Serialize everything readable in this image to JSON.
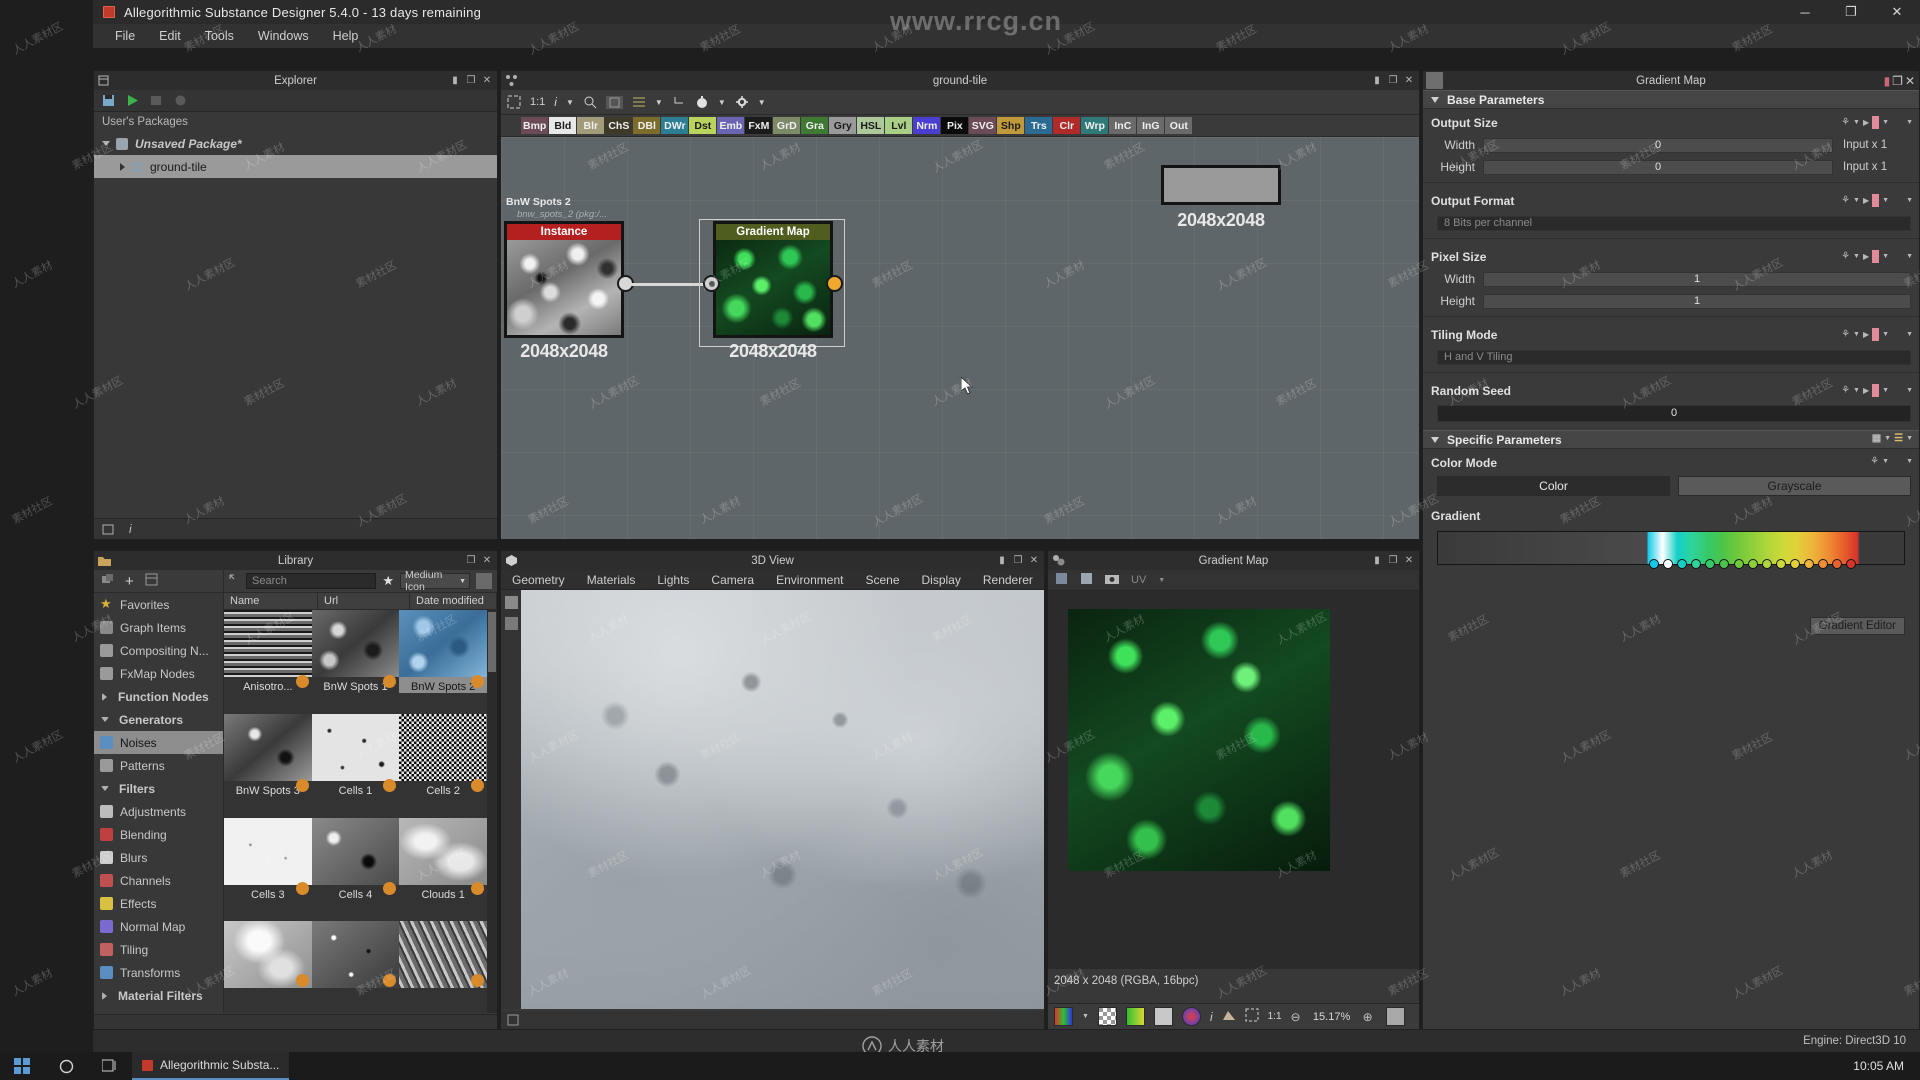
{
  "window": {
    "title": "Allegorithmic Substance Designer 5.4.0 - 13 days remaining",
    "minimize": "─",
    "maximize": "❐",
    "close": "✕"
  },
  "menu": {
    "items": [
      "File",
      "Edit",
      "Tools",
      "Windows",
      "Help"
    ]
  },
  "watermarks": {
    "top": "www.rrcg.cn",
    "center": "人人素材",
    "tiles": [
      "人人素材",
      "人人素材区",
      "素材社区"
    ]
  },
  "explorer": {
    "title": "Explorer",
    "header": "User's Packages",
    "package": "Unsaved Package*",
    "graph": "ground-tile",
    "tools": [
      "save-icon",
      "play-icon",
      "export-icon",
      "cook-icon"
    ],
    "panel_buttons": [
      "pin-icon",
      "float-icon",
      "close-icon"
    ]
  },
  "graph": {
    "title": "ground-tile",
    "toolbar": [
      "frame-icon",
      "1:1",
      "i",
      "search-icon",
      "grid-icon",
      "align-icon",
      "timer-icon",
      "gear-icon"
    ],
    "zoom_label": "1:1",
    "chips": [
      {
        "label": "Bmp",
        "color": "#6b4b57"
      },
      {
        "label": "Bld",
        "color": "#e8e8e8",
        "fg": "#1a1a1a"
      },
      {
        "label": "Blr",
        "color": "#a39c7a"
      },
      {
        "label": "ChS",
        "color": "#3d3a28"
      },
      {
        "label": "DBl",
        "color": "#7d6d2c"
      },
      {
        "label": "DWr",
        "color": "#2b7e93"
      },
      {
        "label": "Dst",
        "color": "#b9d45c",
        "fg": "#1a1a1a"
      },
      {
        "label": "Emb",
        "color": "#6a64b2"
      },
      {
        "label": "FxM",
        "color": "#1b1b1b"
      },
      {
        "label": "GrD",
        "color": "#7d8a6a"
      },
      {
        "label": "Gra",
        "color": "#3f7a33"
      },
      {
        "label": "Gry",
        "color": "#9a9a9a",
        "fg": "#1a1a1a"
      },
      {
        "label": "HSL",
        "color": "#adc89a",
        "fg": "#1a1a1a"
      },
      {
        "label": "Lvl",
        "color": "#a9cf86",
        "fg": "#1a1a1a"
      },
      {
        "label": "Nrm",
        "color": "#4b3fd1"
      },
      {
        "label": "Pix",
        "color": "#0b0b0b"
      },
      {
        "label": "SVG",
        "color": "#6b4b57"
      },
      {
        "label": "Shp",
        "color": "#c09a3a",
        "fg": "#1a1a1a"
      },
      {
        "label": "Trs",
        "color": "#2b6b93"
      },
      {
        "label": "Clr",
        "color": "#b02a2a"
      },
      {
        "label": "Wrp",
        "color": "#2f7a78"
      },
      {
        "label": "InC",
        "color": "#6a6a6a"
      },
      {
        "label": "InG",
        "color": "#6a6a6a"
      },
      {
        "label": "Out",
        "color": "#6a6a6a"
      }
    ],
    "nodes": [
      {
        "name": "Instance",
        "caption": "BnW Spots 2",
        "sub": "bnw_spots_2 (pkg:/...",
        "size": "2048x2048",
        "header_color": "#b4201f"
      },
      {
        "name": "Gradient Map",
        "caption": "",
        "sub": "",
        "size": "2048x2048",
        "header_color": "#4f5e1e"
      }
    ],
    "output_preview_size": "2048x2048"
  },
  "library": {
    "title": "Library",
    "search_placeholder": "Search",
    "view_mode": "Medium Icon",
    "columns": [
      "Name",
      "Url",
      "Date modified"
    ],
    "categories": [
      {
        "label": "Favorites",
        "icon": "star-icon",
        "color": "#d8b43a",
        "group": false,
        "selected": false
      },
      {
        "label": "Graph Items",
        "icon": "graph-icon",
        "color": "#8a8a8a",
        "group": false,
        "selected": false
      },
      {
        "label": "Compositing N...",
        "icon": "node-icon",
        "color": "#9a9a9a",
        "group": false,
        "selected": false
      },
      {
        "label": "FxMap Nodes",
        "icon": "fxmap-icon",
        "color": "#9a9a9a",
        "group": false,
        "selected": false
      },
      {
        "label": "Function Nodes",
        "icon": "arrow-right-icon",
        "color": "#b0b0b0",
        "group": true,
        "selected": false
      },
      {
        "label": "Generators",
        "icon": "arrow-down-icon",
        "color": "#b0b0b0",
        "group": true,
        "selected": false
      },
      {
        "label": "Noises",
        "icon": "noise-icon",
        "color": "#5a8ec0",
        "group": false,
        "selected": true
      },
      {
        "label": "Patterns",
        "icon": "pattern-icon",
        "color": "#9a9a9a",
        "group": false,
        "selected": false
      },
      {
        "label": "Filters",
        "icon": "arrow-down-icon",
        "color": "#b0b0b0",
        "group": true,
        "selected": false
      },
      {
        "label": "Adjustments",
        "icon": "adjust-icon",
        "color": "#bcbcbc",
        "group": false,
        "selected": false
      },
      {
        "label": "Blending",
        "icon": "blend-icon",
        "color": "#c04040",
        "group": false,
        "selected": false
      },
      {
        "label": "Blurs",
        "icon": "blur-icon",
        "color": "#cccccc",
        "group": false,
        "selected": false
      },
      {
        "label": "Channels",
        "icon": "channels-icon",
        "color": "#c05050",
        "group": false,
        "selected": false
      },
      {
        "label": "Effects",
        "icon": "effects-icon",
        "color": "#d8c040",
        "group": false,
        "selected": false
      },
      {
        "label": "Normal Map",
        "icon": "normalmap-icon",
        "color": "#7a6ad0",
        "group": false,
        "selected": false
      },
      {
        "label": "Tiling",
        "icon": "tiling-icon",
        "color": "#c06060",
        "group": false,
        "selected": false
      },
      {
        "label": "Transforms",
        "icon": "transform-icon",
        "color": "#5a8ec0",
        "group": false,
        "selected": false
      },
      {
        "label": "Material Filters",
        "icon": "arrow-right-icon",
        "color": "#b0b0b0",
        "group": true,
        "selected": false
      }
    ],
    "items": [
      {
        "name": "Anisotro...",
        "thumb": "stripes",
        "selected": false
      },
      {
        "name": "BnW Spots 1",
        "thumb": "noise-grey",
        "selected": false
      },
      {
        "name": "BnW Spots 2",
        "thumb": "noise-blue",
        "selected": true
      },
      {
        "name": "BnW Spots 3",
        "thumb": "noise-grey2",
        "selected": false
      },
      {
        "name": "Cells 1",
        "thumb": "cells-light",
        "selected": false
      },
      {
        "name": "Cells 2",
        "thumb": "cells-dark",
        "selected": false
      },
      {
        "name": "Cells 3",
        "thumb": "cells-white",
        "selected": false
      },
      {
        "name": "Cells 4",
        "thumb": "cells-mid",
        "selected": false
      },
      {
        "name": "Clouds 1",
        "thumb": "clouds",
        "selected": false
      },
      {
        "name": "",
        "thumb": "clouds2",
        "selected": false
      },
      {
        "name": "",
        "thumb": "noise-fine",
        "selected": false
      },
      {
        "name": "",
        "thumb": "fibers",
        "selected": false
      }
    ]
  },
  "view3d": {
    "title": "3D View",
    "menu": [
      "Geometry",
      "Materials",
      "Lights",
      "Camera",
      "Environment",
      "Scene",
      "Display",
      "Renderer"
    ]
  },
  "view2d": {
    "title": "Gradient Map",
    "uv_label": "UV",
    "info": "2048 x 2048 (RGBA, 16bpc)",
    "zoom": "15.17%",
    "ratio": "1:1",
    "toolbar": [
      "channels-icon",
      "alpha-icon",
      "color-icon",
      "split-icon",
      "mode-icon",
      "info-icon",
      "histogram-icon",
      "fit-icon"
    ]
  },
  "properties": {
    "tab_title": "Gradient Map",
    "base_parameters": {
      "header": "Base Parameters",
      "output_size": {
        "label": "Output Size",
        "width": {
          "label": "Width",
          "value": "0",
          "suffix": "Input x 1"
        },
        "height": {
          "label": "Height",
          "value": "0",
          "suffix": "Input x 1"
        }
      },
      "output_format": {
        "label": "Output Format",
        "value": "8 Bits per channel"
      },
      "pixel_size": {
        "label": "Pixel Size",
        "width": {
          "label": "Width",
          "value": "1"
        },
        "height": {
          "label": "Height",
          "value": "1"
        }
      },
      "tiling_mode": {
        "label": "Tiling Mode",
        "value": "H and V Tiling"
      },
      "random_seed": {
        "label": "Random Seed",
        "value": "0"
      }
    },
    "specific_parameters": {
      "header": "Specific Parameters",
      "color_mode": {
        "label": "Color Mode",
        "options": [
          "Color",
          "Grayscale"
        ],
        "selected": "Color"
      },
      "gradient": {
        "label": "Gradient",
        "editor_button": "Gradient Editor",
        "stops": [
          "#0ec9e6",
          "#ffffff",
          "#12cfc6",
          "#2fd49a",
          "#35c96a",
          "#4cc44a",
          "#6fc93a",
          "#8fd03a",
          "#afd63a",
          "#cdd93a",
          "#e2cf3a",
          "#eeb53a",
          "#ef8f34",
          "#e9622c",
          "#d8342a"
        ]
      }
    }
  },
  "statusbar": {
    "engine": "Engine: Direct3D 10"
  },
  "taskbar": {
    "app": "Allegorithmic Substa...",
    "clock": "10:05 AM"
  }
}
